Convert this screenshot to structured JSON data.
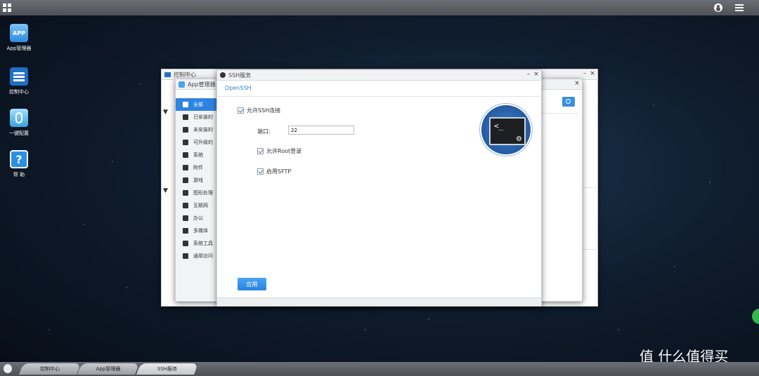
{
  "desktop": {
    "icons": [
      {
        "label": "App管理器",
        "glyph": "APP",
        "icon": "app-manager-icon"
      },
      {
        "label": "控制中心",
        "icon": "control-center-icon"
      },
      {
        "label": "一键配置",
        "icon": "one-click-config-icon"
      },
      {
        "label": "帮 助",
        "glyph": "?",
        "icon": "help-icon"
      }
    ]
  },
  "control_center": {
    "title": "控制中心"
  },
  "app_manager": {
    "title": "App管理器",
    "categories": [
      {
        "label": "全部",
        "icon": "grid-icon"
      },
      {
        "label": "已安装的",
        "icon": "installed-icon"
      },
      {
        "label": "未安装的",
        "icon": "not-installed-icon"
      },
      {
        "label": "可升级的",
        "icon": "upgradable-icon"
      },
      {
        "label": "系统",
        "icon": "windows-icon"
      },
      {
        "label": "附件",
        "icon": "attachment-icon"
      },
      {
        "label": "游戏",
        "icon": "gamepad-icon"
      },
      {
        "label": "图形处理",
        "icon": "image-icon"
      },
      {
        "label": "互联网",
        "icon": "globe-icon"
      },
      {
        "label": "办公",
        "icon": "briefcase-icon"
      },
      {
        "label": "多媒体",
        "icon": "media-icon"
      },
      {
        "label": "系统工具",
        "icon": "gear-icon"
      },
      {
        "label": "通用访问",
        "icon": "person-icon"
      }
    ]
  },
  "ssh": {
    "title": "SSH服务",
    "tab": "OpenSSH",
    "allow_ssh": "允许SSH连接",
    "port_label": "端口:",
    "port_value": "22",
    "allow_root": "允许Root登录",
    "enable_sftp": "启用SFTP",
    "apply": "应用",
    "terminal_prompt": "<_"
  },
  "taskbar": {
    "tabs": [
      "控制中心",
      "App管理器",
      "SSH服务"
    ]
  },
  "watermark": "值 什么值得买",
  "colors": {
    "accent": "#2f84e2"
  }
}
